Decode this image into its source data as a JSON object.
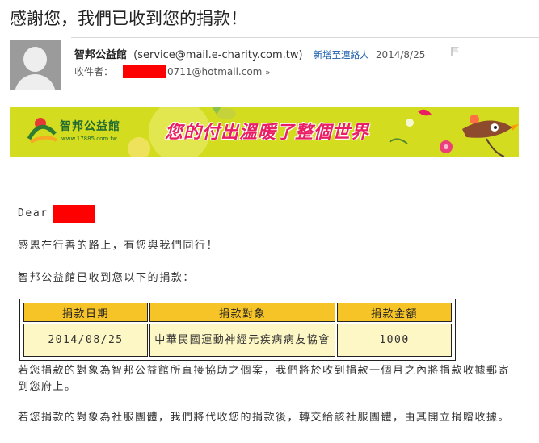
{
  "subject": "感謝您，我們已收到您的捐款！",
  "sender": {
    "name": "智邦公益館",
    "email": "(service@mail.e-charity.com.tw)",
    "add_contact": "新增至連絡人",
    "date": "2014/8/25"
  },
  "recipient": {
    "label": "收件者：",
    "email_suffix": "0711@hotmail.com",
    "chevron": "»"
  },
  "banner": {
    "logo_text": "智邦公益館",
    "url": "www.17885.com.tw",
    "slogan": "您的付出溫暖了整個世界",
    "bg_color": "#d3dc1e",
    "slogan_color": "#e91e63"
  },
  "body": {
    "greeting": "Dear",
    "line1": "感恩在行善的路上，有您與我們同行！",
    "line2": "智邦公益館已收到您以下的捐款：",
    "para1": "若您捐款的對象為智邦公益館所直接協助之個案，我們將於收到捐款一個月之內將捐款收據郵寄到您府上。",
    "para2": "若您捐款的對象為社服團體，我們將代收您的捐款後，轉交給該社服團體，由其開立捐贈收據。"
  },
  "donation_table": {
    "headers": [
      "捐款日期",
      "捐款對象",
      "捐款金額"
    ],
    "rows": [
      [
        "2014/08/25",
        "中華民國運動神經元疾病病友協會",
        "1000"
      ]
    ],
    "header_color": "#f7c427",
    "cell_color": "#fcf7c4"
  },
  "colors": {
    "redaction": "#ff0000",
    "link": "#1a5dab"
  }
}
